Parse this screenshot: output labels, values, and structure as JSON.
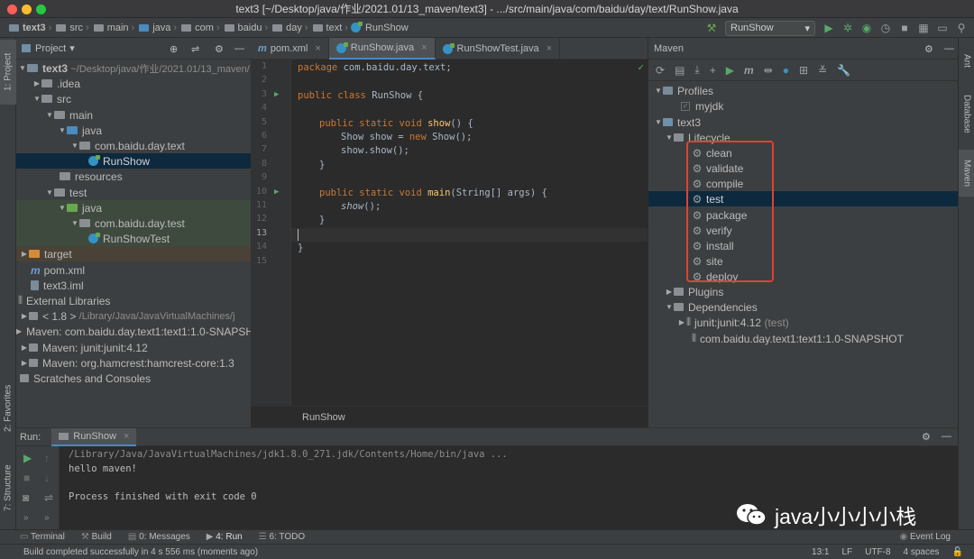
{
  "window": {
    "title": "text3 [~/Desktop/java/作业/2021.01/13_maven/text3] - .../src/main/java/com/baidu/day/text/RunShow.java"
  },
  "breadcrumb": [
    "text3",
    "src",
    "main",
    "java",
    "com",
    "baidu",
    "day",
    "text",
    "RunShow"
  ],
  "toolbar": {
    "run_config": "RunShow"
  },
  "left_strip": {
    "project": "1: Project",
    "favorites": "2: Favorites",
    "structure": "7: Structure"
  },
  "right_strip": {
    "ant": "Ant",
    "database": "Database",
    "maven": "Maven"
  },
  "project": {
    "header": "Project",
    "root_name": "text3",
    "root_path": "~/Desktop/java/作业/2021.01/13_maven/",
    "items": [
      {
        "label": "text3",
        "indent": 0
      },
      {
        "label": ".idea",
        "indent": 1
      },
      {
        "label": "src",
        "indent": 1
      },
      {
        "label": "main",
        "indent": 2
      },
      {
        "label": "java",
        "indent": 3
      },
      {
        "label": "com.baidu.day.text",
        "indent": 4
      },
      {
        "label": "RunShow",
        "indent": 5
      },
      {
        "label": "resources",
        "indent": 3
      },
      {
        "label": "test",
        "indent": 2
      },
      {
        "label": "java",
        "indent": 3
      },
      {
        "label": "com.baidu.day.test",
        "indent": 4
      },
      {
        "label": "RunShowTest",
        "indent": 5
      },
      {
        "label": "target",
        "indent": 1
      },
      {
        "label": "pom.xml",
        "indent": 1
      },
      {
        "label": "text3.iml",
        "indent": 1
      },
      {
        "label": "External Libraries",
        "indent": 0
      },
      {
        "label": "< 1.8 >",
        "indent": 1,
        "extra": "/Library/Java/JavaVirtualMachines/j"
      },
      {
        "label": "Maven: com.baidu.day.text1:text1:1.0-SNAPSHOT",
        "indent": 1
      },
      {
        "label": "Maven: junit:junit:4.12",
        "indent": 1
      },
      {
        "label": "Maven: org.hamcrest:hamcrest-core:1.3",
        "indent": 1
      },
      {
        "label": "Scratches and Consoles",
        "indent": 0
      }
    ]
  },
  "editor": {
    "tabs": [
      "pom.xml",
      "RunShow.java",
      "RunShowTest.java"
    ],
    "line_numbers": [
      "1",
      "2",
      "3",
      "4",
      "5",
      "6",
      "7",
      "8",
      "9",
      "10",
      "11",
      "12",
      "13",
      "14",
      "15"
    ],
    "footer": "RunShow",
    "code": {
      "l1a": "package ",
      "l1b": "com.baidu.day.text;",
      "l3a": "public class ",
      "l3b": "RunShow {",
      "l5a": "public static void ",
      "l5b": "show",
      "l5c": "() {",
      "l6a": "Show show = ",
      "l6b": "new ",
      "l6c": "Show();",
      "l7": "show.show();",
      "l8": "}",
      "l10a": "public static void ",
      "l10b": "main",
      "l10c": "(String[] args) {",
      "l11a": "show",
      "l11b": "();",
      "l12": "}",
      "l14": "}"
    }
  },
  "maven": {
    "header": "Maven",
    "profiles": "Profiles",
    "myjdk": "myjdk",
    "project": "text3",
    "lifecycle": "Lifecycle",
    "phases": [
      "clean",
      "validate",
      "compile",
      "test",
      "package",
      "verify",
      "install",
      "site",
      "deploy"
    ],
    "plugins": "Plugins",
    "dependencies": "Dependencies",
    "dep1": "junit:junit:4.12",
    "dep1_scope": "(test)",
    "dep2": "com.baidu.day.text1:text1:1.0-SNAPSHOT",
    "highlight_color": "#e0422f"
  },
  "run": {
    "label": "Run:",
    "tab": "RunShow",
    "output": [
      "/Library/Java/JavaVirtualMachines/jdk1.8.0_271.jdk/Contents/Home/bin/java ...",
      "hello maven!",
      "",
      "Process finished with exit code 0"
    ]
  },
  "watermark": "java小小小小栈",
  "tool_windows": [
    "Terminal",
    "Build",
    "0: Messages",
    "4: Run",
    "6: TODO"
  ],
  "event_log": "Event Log",
  "status": {
    "message": "Build completed successfully in 4 s 556 ms (moments ago)",
    "position": "13:1",
    "line_sep": "LF",
    "encoding": "UTF-8",
    "indent": "4 spaces"
  }
}
